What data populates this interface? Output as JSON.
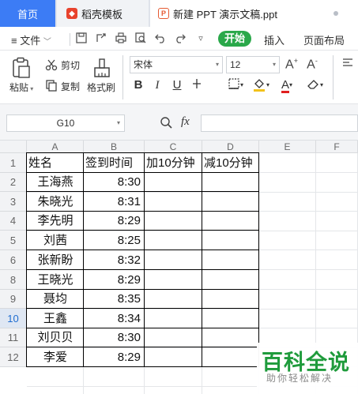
{
  "tabs": {
    "home": "首页",
    "daoke": "稻壳模板",
    "document": "新建 PPT 演示文稿.ppt"
  },
  "menu": {
    "file": "文件",
    "start": "开始",
    "insert": "插入",
    "layout": "页面布局"
  },
  "ribbon": {
    "paste": "粘贴",
    "cut": "剪切",
    "copy": "复制",
    "format_painter": "格式刷",
    "font_name": "宋体",
    "font_size": "12"
  },
  "formula": {
    "cell_ref": "G10",
    "fx": "fx"
  },
  "columns": [
    "A",
    "B",
    "C",
    "D",
    "E",
    "F"
  ],
  "rows": [
    "1",
    "2",
    "3",
    "4",
    "5",
    "6",
    "8",
    "9",
    "10",
    "11",
    "12"
  ],
  "selected_row": "10",
  "table": {
    "headers": [
      "姓名",
      "签到时间",
      "加10分钟",
      "减10分钟"
    ],
    "records": [
      {
        "name": "王海燕",
        "time": "8:30"
      },
      {
        "name": "朱晓光",
        "time": "8:31"
      },
      {
        "name": "李先明",
        "time": "8:29"
      },
      {
        "name": "刘茜",
        "time": "8:25"
      },
      {
        "name": "张新盼",
        "time": "8:32"
      },
      {
        "name": "王晓光",
        "time": "8:29"
      },
      {
        "name": "聂均",
        "time": "8:35"
      },
      {
        "name": "王鑫",
        "time": "8:34"
      },
      {
        "name": "刘贝贝",
        "time": "8:30"
      },
      {
        "name": "李爱",
        "time": "8:29"
      }
    ]
  },
  "watermark": {
    "main": "百科全说",
    "sub": "助你轻松解决"
  }
}
